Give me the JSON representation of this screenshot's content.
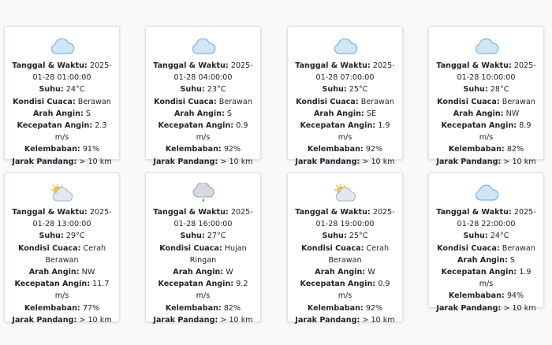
{
  "labels": {
    "datetime": "Tanggal & Waktu:",
    "temp": "Suhu:",
    "condition": "Kondisi Cuaca:",
    "wind_dir": "Arah Angin:",
    "wind_speed": "Kecepatan Angin:",
    "humidity": "Kelembaban:",
    "visibility": "Jarak Pandang:"
  },
  "cards": [
    {
      "icon": "cloud-icon",
      "datetime": "2025-01-28 01:00:00",
      "temp": "24°C",
      "condition": "Berawan",
      "wind_dir": "S",
      "wind_speed": "2.3 m/s",
      "humidity": "91%",
      "visibility": "> 10 km"
    },
    {
      "icon": "cloud-icon",
      "datetime": "2025-01-28 04:00:00",
      "temp": "23°C",
      "condition": "Berawan",
      "wind_dir": "S",
      "wind_speed": "0.9 m/s",
      "humidity": "92%",
      "visibility": "> 10 km"
    },
    {
      "icon": "cloud-icon",
      "datetime": "2025-01-28 07:00:00",
      "temp": "25°C",
      "condition": "Berawan",
      "wind_dir": "SE",
      "wind_speed": "1.9 m/s",
      "humidity": "92%",
      "visibility": "> 10 km"
    },
    {
      "icon": "cloud-icon",
      "datetime": "2025-01-28 10:00:00",
      "temp": "28°C",
      "condition": "Berawan",
      "wind_dir": "NW",
      "wind_speed": "8.9 m/s",
      "humidity": "82%",
      "visibility": "> 10 km"
    },
    {
      "icon": "partly-sunny-icon",
      "datetime": "2025-01-28 13:00:00",
      "temp": "29°C",
      "condition": "Cerah Berawan",
      "wind_dir": "NW",
      "wind_speed": "11.7 m/s",
      "humidity": "77%",
      "visibility": "> 10 km"
    },
    {
      "icon": "rain-cloud-icon",
      "datetime": "2025-01-28 16:00:00",
      "temp": "27°C",
      "condition": "Hujan Ringan",
      "wind_dir": "W",
      "wind_speed": "9.2 m/s",
      "humidity": "82%",
      "visibility": "> 10 km"
    },
    {
      "icon": "partly-sunny-icon",
      "datetime": "2025-01-28 19:00:00",
      "temp": "25°C",
      "condition": "Cerah Berawan",
      "wind_dir": "W",
      "wind_speed": "0.9 m/s",
      "humidity": "92%",
      "visibility": "> 10 km"
    },
    {
      "icon": "cloud-icon",
      "datetime": "2025-01-28 22:00:00",
      "temp": "24°C",
      "condition": "Berawan",
      "wind_dir": "S",
      "wind_speed": "1.9 m/s",
      "humidity": "94%",
      "visibility": "> 10 km"
    }
  ]
}
